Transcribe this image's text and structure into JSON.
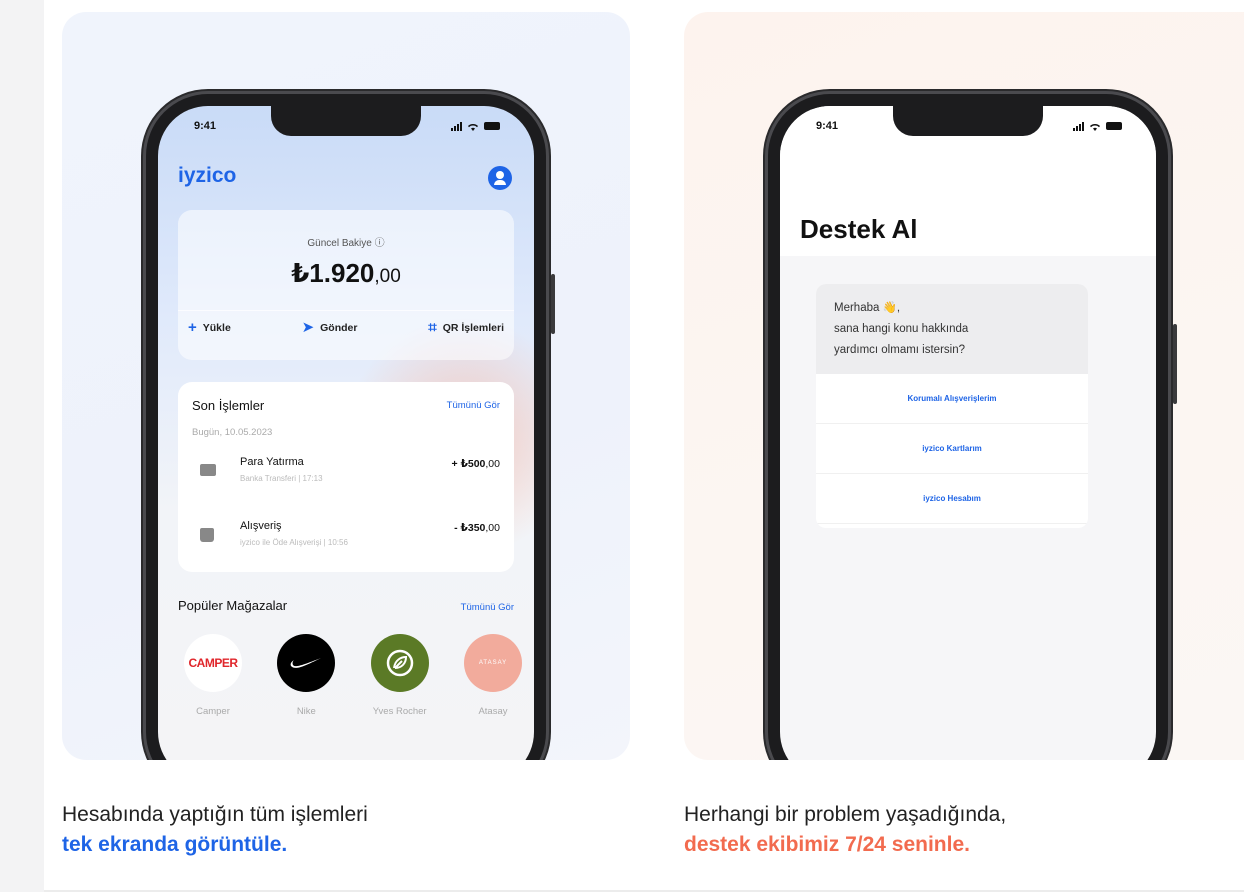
{
  "left_panel": {
    "phone": {
      "status_time": "9:41",
      "brand": "iyzico",
      "balance_label": "Güncel Bakiye ⓘ",
      "balance_main": "₺1.920",
      "balance_decimal": ",00",
      "actions": [
        {
          "icon": "plus-icon",
          "label": "Yükle"
        },
        {
          "icon": "send-icon",
          "label": "Gönder"
        },
        {
          "icon": "qr-icon",
          "label": "QR İşlemleri"
        }
      ],
      "recent_title": "Son İşlemler",
      "recent_link": "Tümünü Gör",
      "recent_date": "Bugün, 10.05.2023",
      "transactions": [
        {
          "name": "Para Yatırma",
          "sub": "Banka Transferi | 17:13",
          "amount_main": "+ ₺500",
          "amount_dec": ",00",
          "icon": "cash-icon"
        },
        {
          "name": "Alışveriş",
          "sub": "iyzico ile Öde Alışverişi | 10:56",
          "amount_main": "- ₺350",
          "amount_dec": ",00",
          "icon": "shopping-bag-icon"
        }
      ],
      "popular_title": "Popüler Mağazalar",
      "popular_link": "Tümünü Gör",
      "stores": [
        {
          "name": "Camper",
          "logo_text": "CAMPER"
        },
        {
          "name": "Nike",
          "logo_text": ""
        },
        {
          "name": "Yves Rocher",
          "logo_text": ""
        },
        {
          "name": "Atasay",
          "logo_text": "ATASAY"
        }
      ]
    },
    "caption_line1": "Hesabında yaptığın tüm işlemleri",
    "caption_line2": "tek ekranda görüntüle."
  },
  "right_panel": {
    "phone": {
      "status_time": "9:41",
      "title": "Destek Al",
      "message_line1": "Merhaba 👋,",
      "message_line2": "sana hangi konu hakkında",
      "message_line3": "yardımcı olmamı istersin?",
      "options": [
        "Korumalı Alışverişlerim",
        "iyzico Kartlarım",
        "iyzico Hesabım"
      ]
    },
    "caption_line1": "Herhangi bir problem yaşadığında,",
    "caption_line2": "destek ekibimiz 7/24 seninle."
  },
  "colors": {
    "brand_blue": "#1e64e6",
    "accent_orange": "#f26b4f"
  }
}
